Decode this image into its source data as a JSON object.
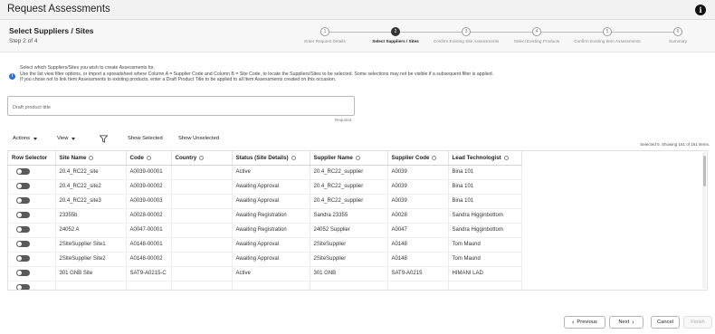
{
  "app": {
    "title": "Request Assessments",
    "info_icon": "info-icon"
  },
  "header": {
    "title": "Select Suppliers / Sites",
    "step_counter": "Step 2 of 4"
  },
  "stepper": [
    {
      "number": "1",
      "label": "Enter Request Details",
      "state": "done"
    },
    {
      "number": "2",
      "label": "Select Suppliers / Sites",
      "state": "current"
    },
    {
      "number": "3",
      "label": "Confirm Existing Site Assessments",
      "state": "todo"
    },
    {
      "number": "4",
      "label": "Select Existing Products",
      "state": "todo"
    },
    {
      "number": "5",
      "label": "Confirm Existing Item Assessments",
      "state": "todo"
    },
    {
      "number": "6",
      "label": "Summary",
      "state": "todo"
    }
  ],
  "instructions": {
    "line1": "Select which Suppliers/Sites you wish to create Assessments for.",
    "line2": "Use the list view filter options, or import a spreadsheet where Column A = Supplier Code and Column B = Site Code, to locate the Suppliers/Sites to be selected. Some selections may not be visible if a subsequent filter is applied.",
    "line3": "If you chose not to link Item Assessments to existing products, enter a Draft Product Title to be applied to all Item Assessments created on this occasion."
  },
  "draft": {
    "placeholder": "Draft product title",
    "value": "",
    "required_note": "Required"
  },
  "toolbar": {
    "actions_label": "Actions",
    "view_label": "View",
    "show_selected": "Show Selected",
    "show_unselected": "Show Unselected",
    "selection_summary": "Selected 0,  Showing 161 of 161 items."
  },
  "table": {
    "columns": [
      "Row Selector",
      "Site Name",
      "Code",
      "Country",
      "Status (Site Details)",
      "Supplier Name",
      "Supplier Code",
      "Lead Technologist"
    ],
    "sortable": [
      false,
      true,
      true,
      true,
      true,
      true,
      true,
      true
    ],
    "rows": [
      [
        "",
        "20.4_RC22_site",
        "A0039-00001",
        "",
        "Active",
        "20.4_RC22_supplier",
        "A0039",
        "Bina 101"
      ],
      [
        "",
        "20.4_RC22_site2",
        "A0039-00002",
        "",
        "Awaiting Approval",
        "20.4_RC22_supplier",
        "A0039",
        "Bina 101"
      ],
      [
        "",
        "20.4_RC22_site3",
        "A0039-00003",
        "",
        "Awaiting Approval",
        "20.4_RC22_supplier",
        "A0039",
        "Bina 101"
      ],
      [
        "",
        "23355b",
        "A0028-00002",
        "",
        "Awaiting Registration",
        "Sandra 23355",
        "A0028",
        "Sandra Higginbottom"
      ],
      [
        "",
        "24052 A",
        "A0047-00001",
        "",
        "Awaiting Registration",
        "24052 Supplier",
        "A0047",
        "Sandra Higginbottom"
      ],
      [
        "",
        "2SiteSupplier Site1",
        "A0148-00001",
        "",
        "Awaiting Approval",
        "2SiteSupplier",
        "A0148",
        "Tom Maund"
      ],
      [
        "",
        "2SiteSupplier Site2",
        "A0148-00002",
        "",
        "Awaiting Approval",
        "2SiteSupplier",
        "A0148",
        "Tom Maund"
      ],
      [
        "",
        "301 GNB Site",
        "SAT9-A0215-C",
        "",
        "Active",
        "301 GNB",
        "SAT9-A0215",
        "HIMANI LAD"
      ],
      [
        "",
        "",
        "",
        "",
        "",
        "",
        "",
        ""
      ]
    ]
  },
  "footer": {
    "previous": "Previous",
    "next": "Next",
    "cancel": "Cancel",
    "finish": "Finish"
  }
}
